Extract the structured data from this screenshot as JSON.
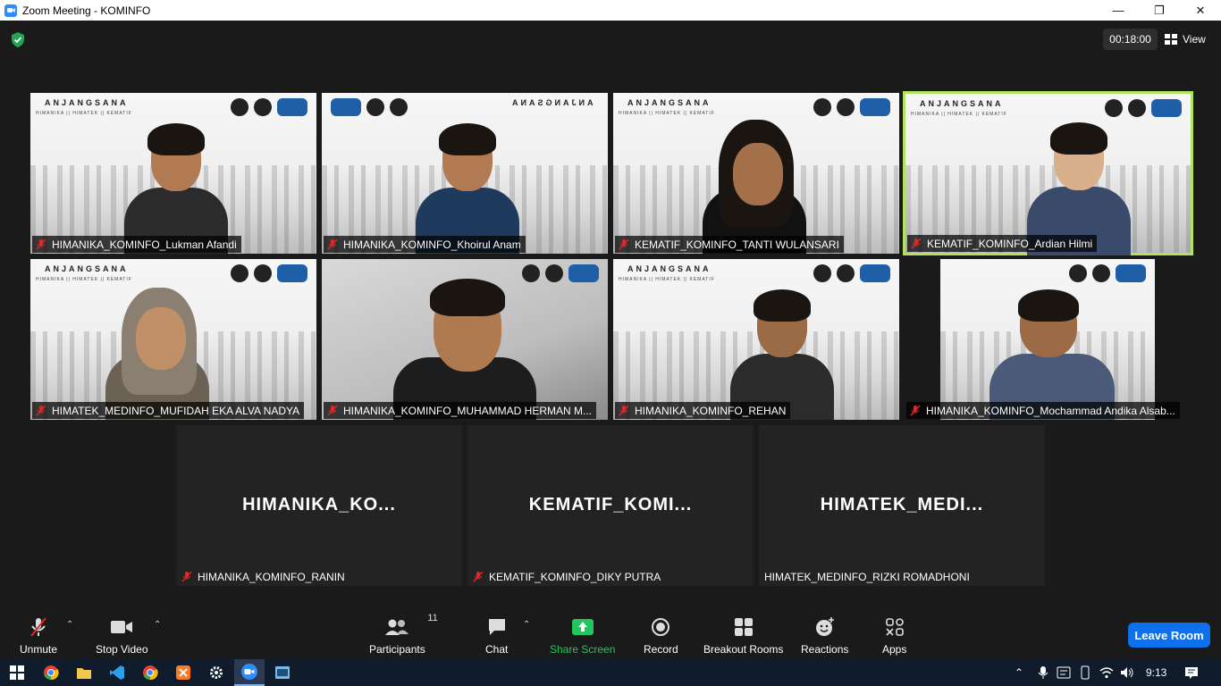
{
  "window": {
    "title": "Zoom Meeting - KOMINFO",
    "controls": [
      "minimize",
      "maximize",
      "close"
    ]
  },
  "topbar": {
    "timer": "00:18:00",
    "view_label": "View"
  },
  "banner": {
    "title": "ANJANGSANA",
    "subtitle": "HIMANIKA || HIMATEK || KEMATIF"
  },
  "participants_grid": [
    {
      "name": "HIMANIKA_KOMINFO_Lukman Afandi",
      "muted": true,
      "video": true
    },
    {
      "name": "HIMANIKA_KOMINFO_Khoirul Anam",
      "muted": true,
      "video": true
    },
    {
      "name": "KEMATIF_KOMINFO_TANTI WULANSARI",
      "muted": true,
      "video": true
    },
    {
      "name": "KEMATIF_KOMINFO_Ardian Hilmi",
      "muted": true,
      "video": true,
      "active_speaker": true
    },
    {
      "name": "HIMATEK_MEDINFO_MUFIDAH EKA ALVA NADYA",
      "muted": true,
      "video": true
    },
    {
      "name": "HIMANIKA_KOMINFO_MUHAMMAD HERMAN M...",
      "muted": true,
      "video": true
    },
    {
      "name": "HIMANIKA_KOMINFO_REHAN",
      "muted": true,
      "video": true
    },
    {
      "name": "HIMANIKA_KOMINFO_Mochammad Andika Alsab...",
      "muted": true,
      "video": true
    },
    {
      "name": "HIMANIKA_KOMINFO_RANIN",
      "muted": true,
      "video": false,
      "display_name": "HIMANIKA_KO..."
    },
    {
      "name": "KEMATIF_KOMINFO_DIKY PUTRA",
      "muted": true,
      "video": false,
      "display_name": "KEMATIF_KOMI..."
    },
    {
      "name": "HIMATEK_MEDINFO_RIZKI ROMADHONI",
      "muted": false,
      "video": false,
      "display_name": "HIMATEK_MEDI..."
    }
  ],
  "toolbar": {
    "unmute": "Unmute",
    "stop_video": "Stop Video",
    "participants": "Participants",
    "participants_count": "11",
    "chat": "Chat",
    "share_screen": "Share Screen",
    "record": "Record",
    "breakout_rooms": "Breakout Rooms",
    "reactions": "Reactions",
    "apps": "Apps",
    "leave": "Leave Room",
    "share_color": "#22c55e"
  },
  "taskbar": {
    "time": "9:13",
    "apps": [
      "start-icon",
      "chrome-icon",
      "file-explorer-icon",
      "vscode-icon",
      "chrome-icon",
      "xampp-icon",
      "settings-icon",
      "zoom-icon",
      "app-icon"
    ]
  }
}
